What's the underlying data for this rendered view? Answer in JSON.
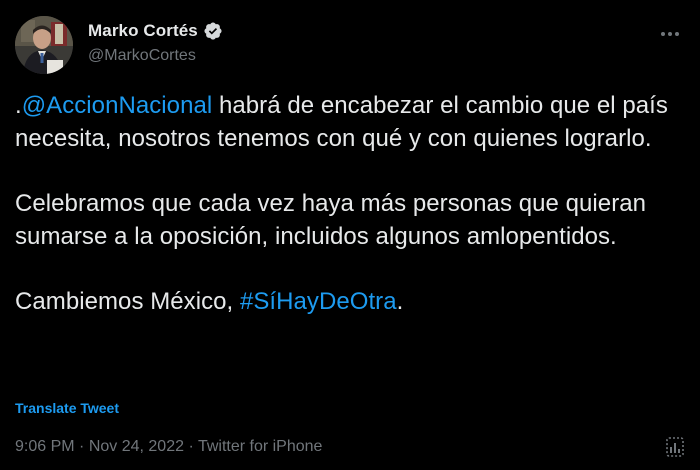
{
  "author": {
    "display_name": "Marko Cortés",
    "handle": "@MarkoCortes",
    "verified": true,
    "avatar": "profile-photo-avatar"
  },
  "tweet": {
    "prefix": ".",
    "mention": "@AccionNacional",
    "line1_rest": " habrá de encabezar el cambio que el país necesita, nosotros tenemos con qué y con quienes lograrlo.",
    "paragraph2": "Celebramos que cada vez haya más personas que quieran sumarse a la oposición, incluidos algunos amlopentidos.",
    "closing_text": "Cambiemos México, ",
    "hashtag": "#SíHayDeOtra",
    "closing_punct": "."
  },
  "translate_label": "Translate Tweet",
  "meta": {
    "time": "9:06 PM",
    "separator1": " · ",
    "date": "Nov 24, 2022",
    "separator2": " · ",
    "source": "Twitter for iPhone"
  },
  "icons": {
    "more": "more-dots-icon",
    "verified": "verified-badge-icon",
    "analytics": "analytics-icon"
  },
  "colors": {
    "background": "#000000",
    "text": "#e7e9ea",
    "muted": "#71767b",
    "accent": "#1d9bf0"
  }
}
